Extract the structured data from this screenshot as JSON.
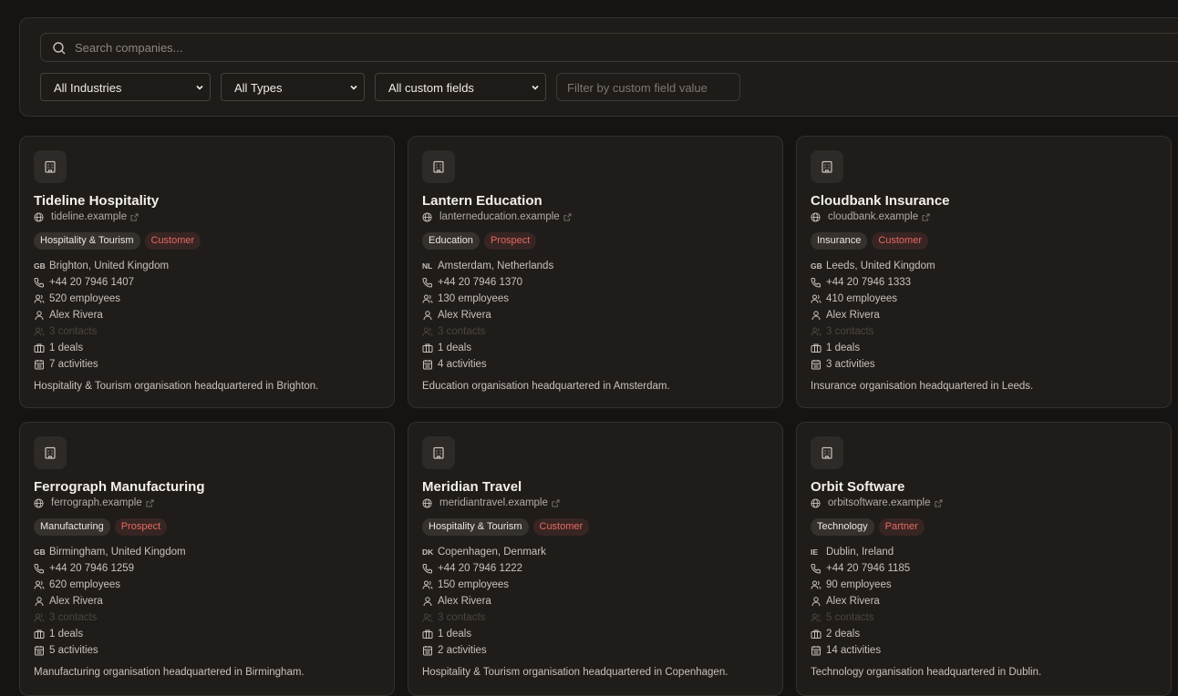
{
  "search": {
    "placeholder": "Search companies..."
  },
  "filters": {
    "industry": "All Industries",
    "type": "All Types",
    "custom_field": "All custom fields",
    "custom_value_placeholder": "Filter by custom field value"
  },
  "colors": {
    "accent": "#e56a5e",
    "card_bg": "#1f1c1a",
    "page_bg": "#161412"
  },
  "cards": [
    {
      "name": "Tideline Hospitality",
      "website": "tideline.example",
      "industry": "Hospitality & Tourism",
      "type": "Customer",
      "country": "GB",
      "location": "Brighton, United Kingdom",
      "phone": "+44 20 7946 1407",
      "employees": "520 employees",
      "owner": "Alex Rivera",
      "contacts": "3 contacts",
      "deals": "1 deals",
      "activities": "7 activities",
      "description": "Hospitality & Tourism organisation headquartered in Brighton."
    },
    {
      "name": "Lantern Education",
      "website": "lanterneducation.example",
      "industry": "Education",
      "type": "Prospect",
      "country": "NL",
      "location": "Amsterdam, Netherlands",
      "phone": "+44 20 7946 1370",
      "employees": "130 employees",
      "owner": "Alex Rivera",
      "contacts": "3 contacts",
      "deals": "1 deals",
      "activities": "4 activities",
      "description": "Education organisation headquartered in Amsterdam."
    },
    {
      "name": "Cloudbank Insurance",
      "website": "cloudbank.example",
      "industry": "Insurance",
      "type": "Customer",
      "country": "GB",
      "location": "Leeds, United Kingdom",
      "phone": "+44 20 7946 1333",
      "employees": "410 employees",
      "owner": "Alex Rivera",
      "contacts": "3 contacts",
      "deals": "1 deals",
      "activities": "3 activities",
      "description": "Insurance organisation headquartered in Leeds."
    },
    {
      "name": "Ferrograph Manufacturing",
      "website": "ferrograph.example",
      "industry": "Manufacturing",
      "type": "Prospect",
      "country": "GB",
      "location": "Birmingham, United Kingdom",
      "phone": "+44 20 7946 1259",
      "employees": "620 employees",
      "owner": "Alex Rivera",
      "contacts": "3 contacts",
      "deals": "1 deals",
      "activities": "5 activities",
      "description": "Manufacturing organisation headquartered in Birmingham."
    },
    {
      "name": "Meridian Travel",
      "website": "meridiantravel.example",
      "industry": "Hospitality & Tourism",
      "type": "Customer",
      "country": "DK",
      "location": "Copenhagen, Denmark",
      "phone": "+44 20 7946 1222",
      "employees": "150 employees",
      "owner": "Alex Rivera",
      "contacts": "3 contacts",
      "deals": "1 deals",
      "activities": "2 activities",
      "description": "Hospitality & Tourism organisation headquartered in Copenhagen."
    },
    {
      "name": "Orbit Software",
      "website": "orbitsoftware.example",
      "industry": "Technology",
      "type": "Partner",
      "country": "IE",
      "location": "Dublin, Ireland",
      "phone": "+44 20 7946 1185",
      "employees": "90 employees",
      "owner": "Alex Rivera",
      "contacts": "5 contacts",
      "deals": "2 deals",
      "activities": "14 activities",
      "description": "Technology organisation headquartered in Dublin."
    }
  ]
}
